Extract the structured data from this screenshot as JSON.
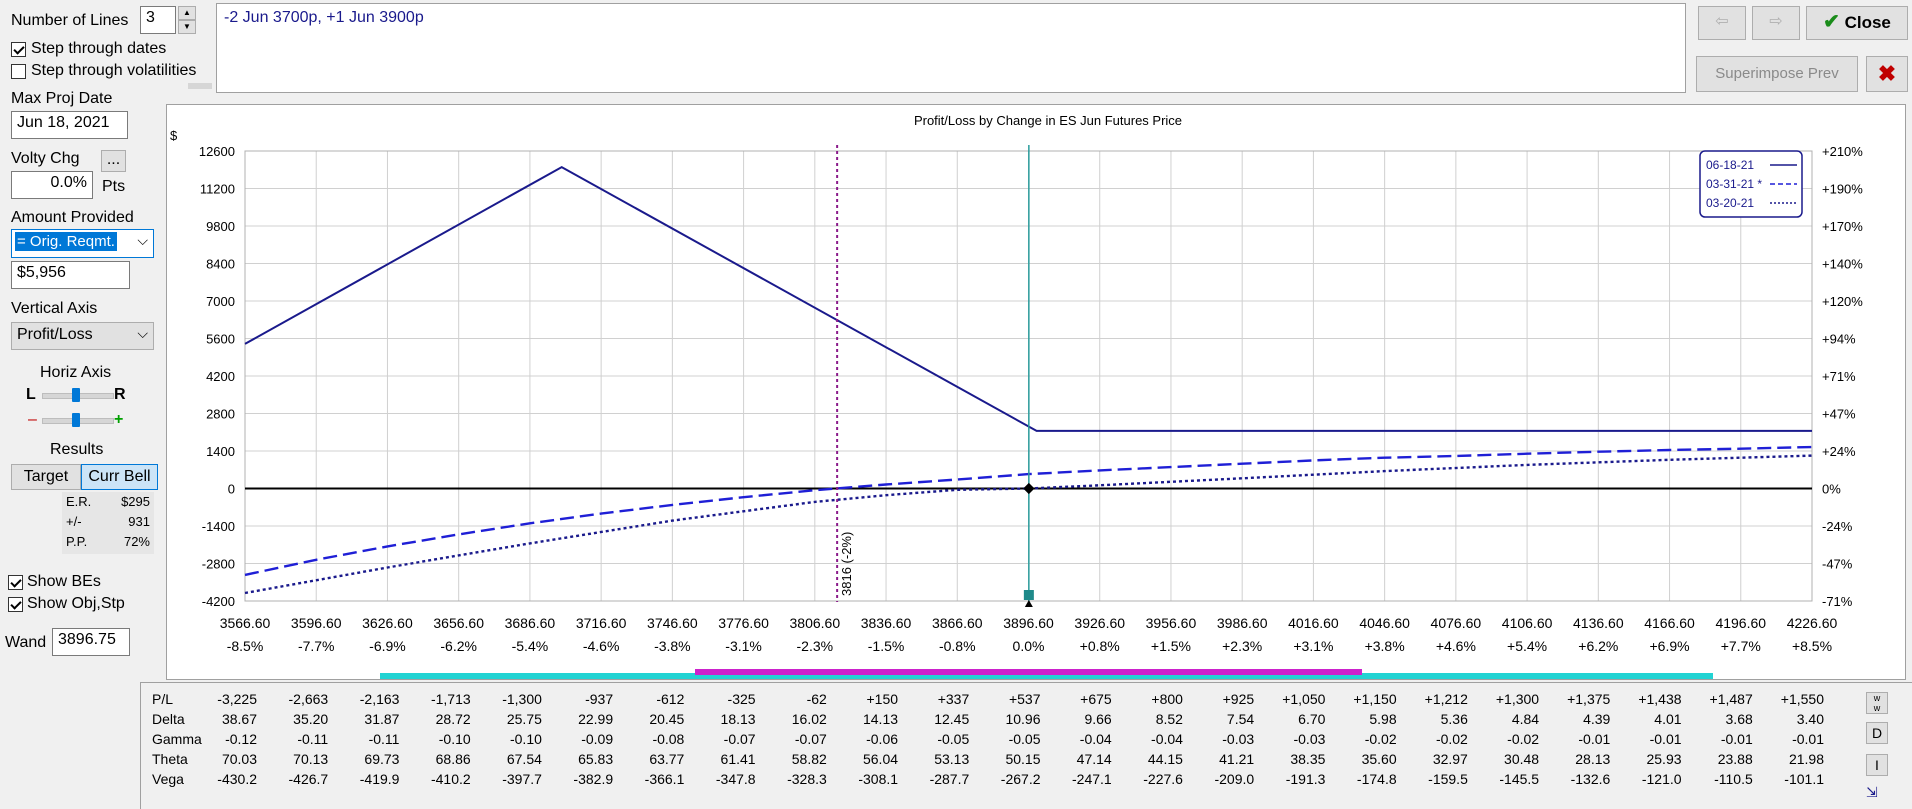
{
  "left_panel": {
    "lines_label": "Number of Lines",
    "lines_value": "3",
    "step_dates_label": "Step through dates",
    "step_dates_checked": true,
    "step_vols_label": "Step through volatilities",
    "step_vols_checked": false,
    "max_proj_label": "Max Proj Date",
    "max_proj_value": "Jun 18, 2021",
    "volty_label": "Volty Chg",
    "volty_btn": "...",
    "volty_value": "0.0%",
    "volty_unit": "Pts",
    "amount_label": "Amount Provided",
    "amount_select": "= Orig. Reqmt.",
    "amount_value": "$5,956",
    "vaxis_label": "Vertical Axis",
    "vaxis_value": "Profit/Loss",
    "haxis_label": "Horiz Axis",
    "haxis_l": "L",
    "haxis_r": "R",
    "zoom_minus": "–",
    "zoom_plus": "+",
    "results_label": "Results",
    "target_btn": "Target",
    "currbell_btn": "Curr Bell",
    "er_label": "E.R.",
    "er_value": "$295",
    "pm_label": "+/-",
    "pm_value": "931",
    "pp_label": "P.P.",
    "pp_value": "72%",
    "show_bes_label": "Show BEs",
    "show_bes_checked": true,
    "show_obj_label": "Show Obj,Stp",
    "show_obj_checked": true,
    "wand_label": "Wand",
    "wand_value": "3896.75"
  },
  "position_text": "-2 Jun 3700p, +1 Jun 3900p",
  "toolbar": {
    "close_label": "Close",
    "superimpose_label": "Superimpose Prev"
  },
  "chart_data": {
    "type": "line",
    "title": "Profit/Loss by Change in ES Jun Futures Price",
    "ylabel": "$",
    "x": [
      3566.6,
      3596.6,
      3626.6,
      3656.6,
      3686.6,
      3716.6,
      3746.6,
      3776.6,
      3806.6,
      3836.6,
      3866.6,
      3896.6,
      3926.6,
      3956.6,
      3986.6,
      4016.6,
      4046.6,
      4076.6,
      4106.6,
      4136.6,
      4166.6,
      4196.6,
      4226.6
    ],
    "x_tick_labels": [
      "3566.60",
      "3596.60",
      "3626.60",
      "3656.60",
      "3686.60",
      "3716.60",
      "3746.60",
      "3776.60",
      "3806.60",
      "3836.60",
      "3866.60",
      "3896.60",
      "3926.60",
      "3956.60",
      "3986.60",
      "4016.60",
      "4046.60",
      "4076.60",
      "4106.60",
      "4136.60",
      "4166.60",
      "4196.60",
      "4226.60"
    ],
    "x_pct_labels": [
      "-8.5%",
      "-7.7%",
      "-6.9%",
      "-6.2%",
      "-5.4%",
      "-4.6%",
      "-3.8%",
      "-3.1%",
      "-2.3%",
      "-1.5%",
      "-0.8%",
      "0.0%",
      "+0.8%",
      "+1.5%",
      "+2.3%",
      "+3.1%",
      "+3.8%",
      "+4.6%",
      "+5.4%",
      "+6.2%",
      "+6.9%",
      "+7.7%",
      "+8.5%"
    ],
    "ylim": [
      -4200,
      12600
    ],
    "y_ticks": [
      12600,
      11200,
      9800,
      8400,
      7000,
      5600,
      4200,
      2800,
      1400,
      0,
      -1400,
      -2800,
      -4200
    ],
    "y_tick_labels": [
      "12600",
      "11200",
      "9800",
      "8400",
      "7000",
      "5600",
      "4200",
      "2800",
      "1400",
      "0",
      "-1400",
      "-2800",
      "-4200"
    ],
    "y2_tick_labels": [
      "+210%",
      "+190%",
      "+170%",
      "+140%",
      "+120%",
      "+94%",
      "+71%",
      "+47%",
      "+24%",
      "0%",
      "-24%",
      "-47%",
      "-71%"
    ],
    "series": [
      {
        "name": "06-18-21",
        "style": "solid",
        "color": "#1a1a8c",
        "points": [
          [
            3566.6,
            5400
          ],
          [
            3700,
            12000
          ],
          [
            3900,
            2150
          ],
          [
            4226.6,
            2150
          ]
        ]
      },
      {
        "name": "03-31-21 *",
        "style": "dash",
        "color": "#1f1fd6",
        "values": [
          -3225,
          -2663,
          -2163,
          -1713,
          -1300,
          -937,
          -612,
          -325,
          -62,
          150,
          337,
          537,
          675,
          800,
          925,
          1050,
          1150,
          1212,
          1300,
          1375,
          1438,
          1487,
          1550
        ]
      },
      {
        "name": "03-20-21",
        "style": "dot",
        "color": "#1a1a8c",
        "points": [
          [
            3566.6,
            -3900
          ],
          [
            3626.6,
            -2950
          ],
          [
            3686.6,
            -2050
          ],
          [
            3746.6,
            -1200
          ],
          [
            3806.6,
            -500
          ],
          [
            3836.6,
            -250
          ],
          [
            3866.6,
            -50
          ],
          [
            3896.6,
            0
          ],
          [
            3926.6,
            120
          ],
          [
            3986.6,
            380
          ],
          [
            4046.6,
            650
          ],
          [
            4106.6,
            880
          ],
          [
            4166.6,
            1070
          ],
          [
            4226.6,
            1230
          ]
        ]
      }
    ],
    "breakeven": {
      "x": 3816,
      "label": "3816 (-2%)"
    },
    "current_x": 3896.75,
    "grid": true,
    "legend_position": "top-right"
  },
  "table": {
    "rows": [
      {
        "label": "P/L",
        "values": [
          "-3,225",
          "-2,663",
          "-2,163",
          "-1,713",
          "-1,300",
          "-937",
          "-612",
          "-325",
          "-62",
          "+150",
          "+337",
          "+537",
          "+675",
          "+800",
          "+925",
          "+1,050",
          "+1,150",
          "+1,212",
          "+1,300",
          "+1,375",
          "+1,438",
          "+1,487",
          "+1,550"
        ]
      },
      {
        "label": "Delta",
        "values": [
          "38.67",
          "35.20",
          "31.87",
          "28.72",
          "25.75",
          "22.99",
          "20.45",
          "18.13",
          "16.02",
          "14.13",
          "12.45",
          "10.96",
          "9.66",
          "8.52",
          "7.54",
          "6.70",
          "5.98",
          "5.36",
          "4.84",
          "4.39",
          "4.01",
          "3.68",
          "3.40"
        ]
      },
      {
        "label": "Gamma",
        "values": [
          "-0.12",
          "-0.11",
          "-0.11",
          "-0.10",
          "-0.10",
          "-0.09",
          "-0.08",
          "-0.07",
          "-0.07",
          "-0.06",
          "-0.05",
          "-0.05",
          "-0.04",
          "-0.04",
          "-0.03",
          "-0.03",
          "-0.02",
          "-0.02",
          "-0.02",
          "-0.01",
          "-0.01",
          "-0.01",
          "-0.01"
        ]
      },
      {
        "label": "Theta",
        "values": [
          "70.03",
          "70.13",
          "69.73",
          "68.86",
          "67.54",
          "65.83",
          "63.77",
          "61.41",
          "58.82",
          "56.04",
          "53.13",
          "50.15",
          "47.14",
          "44.15",
          "41.21",
          "38.35",
          "35.60",
          "32.97",
          "30.48",
          "28.13",
          "25.93",
          "23.88",
          "21.98"
        ]
      },
      {
        "label": "Vega",
        "values": [
          "-430.2",
          "-426.7",
          "-419.9",
          "-410.2",
          "-397.7",
          "-382.9",
          "-366.1",
          "-347.8",
          "-328.3",
          "-308.1",
          "-287.7",
          "-267.2",
          "-247.1",
          "-227.6",
          "-209.0",
          "-191.3",
          "-174.8",
          "-159.5",
          "-145.5",
          "-132.6",
          "-121.0",
          "-110.5",
          "-101.1"
        ]
      }
    ],
    "side_buttons": [
      "D",
      "I"
    ]
  },
  "colors": {
    "accent": "#0078d7",
    "cyan_bar": "#22d3d3",
    "magenta_bar": "#cc22cc",
    "close_x": "#c00000"
  }
}
